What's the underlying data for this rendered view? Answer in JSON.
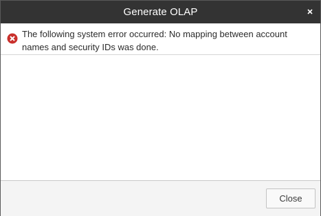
{
  "window": {
    "title": "Generate OLAP",
    "close_icon": "close-icon"
  },
  "message": {
    "icon": "error-icon",
    "icon_color": "#c9302c",
    "text": "The following system error occurred: No mapping between account names and security IDs was done."
  },
  "footer": {
    "close_label": "Close"
  }
}
